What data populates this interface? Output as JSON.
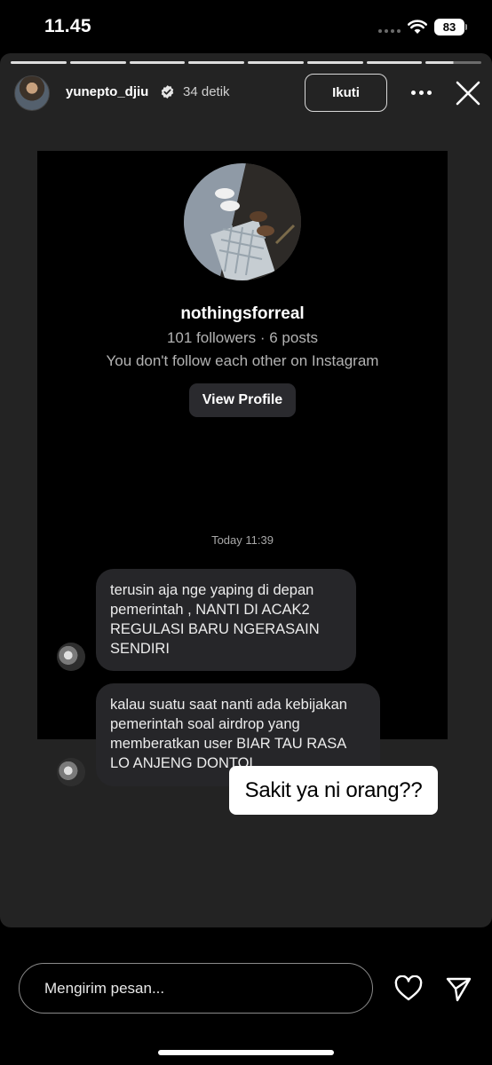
{
  "status_bar": {
    "time": "11.45",
    "battery": "83"
  },
  "story": {
    "username": "yunepto_djiu",
    "time_ago": "34 detik",
    "follow_label": "Ikuti",
    "segments": 8
  },
  "screenshot": {
    "profile_name": "nothingsforreal",
    "profile_stats": "101 followers · 6 posts",
    "profile_note": "You don't follow each other on Instagram",
    "view_profile_label": "View Profile",
    "timestamp": "Today 11:39",
    "messages": [
      "terusin aja nge yaping di depan pemerintah , NANTI DI ACAK2 REGULASI BARU NGERASAIN SENDIRI",
      "kalau suatu saat nanti ada kebijakan pemerintah soal airdrop yang memberatkan user BIAR TAU RASA LO ANJENG DONTOL"
    ]
  },
  "sticker_text": "Sakit ya ni orang??",
  "reply": {
    "placeholder": "Mengirim pesan..."
  },
  "colors": {
    "story_background": "#232323",
    "bubble": "#262629",
    "screen_background": "#000000"
  },
  "icons": [
    "wifi-icon",
    "verified-icon",
    "more-icon",
    "close-icon",
    "heart-icon",
    "send-icon"
  ]
}
